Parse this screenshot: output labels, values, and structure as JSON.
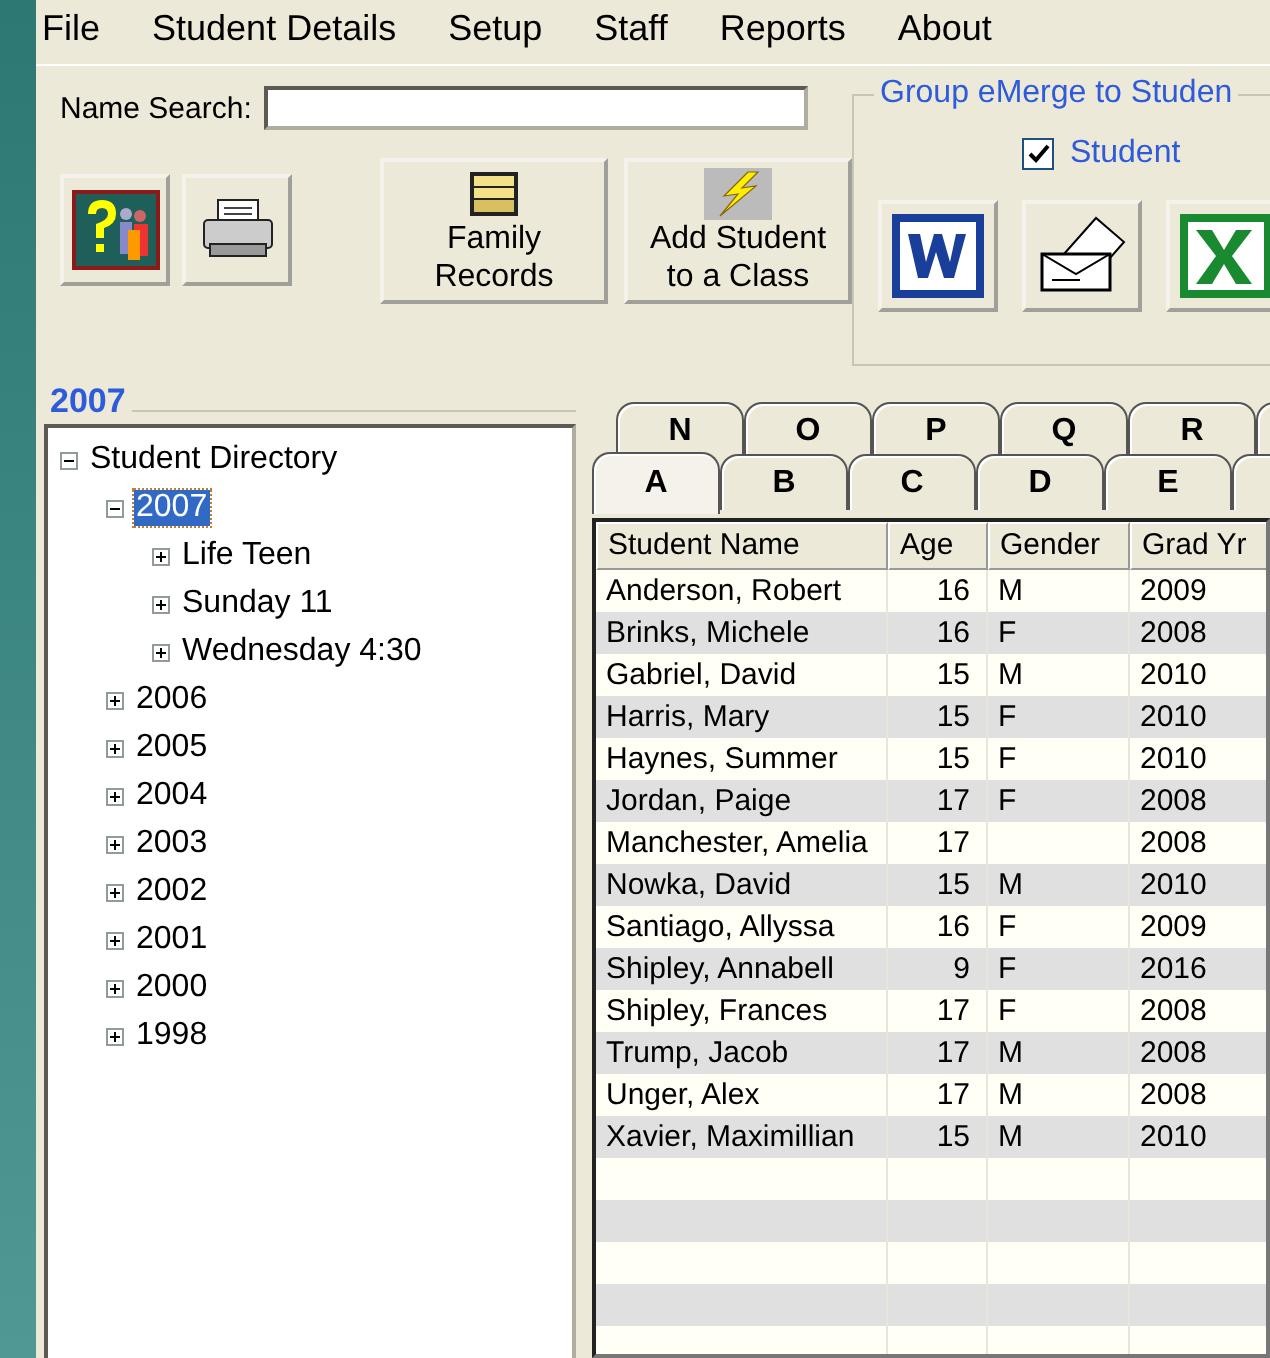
{
  "menu": [
    "File",
    "Student Details",
    "Setup",
    "Staff",
    "Reports",
    "About"
  ],
  "name_search": {
    "label": "Name Search:"
  },
  "toolbar": [
    {
      "kind": "help"
    },
    {
      "kind": "print"
    },
    {
      "kind": "family",
      "label": "Family\nRecords"
    },
    {
      "kind": "add",
      "label": "Add Student\nto a Class"
    }
  ],
  "group": {
    "title": "Group eMerge to Studen",
    "student": {
      "label": "Student",
      "checked": true
    },
    "buttons": [
      {
        "kind": "word"
      },
      {
        "kind": "letter"
      },
      {
        "kind": "excel"
      }
    ]
  },
  "tree_panel": {
    "title": "2007",
    "tree": [
      {
        "label": "Student Directory",
        "expanded": true,
        "selected": false,
        "children": [
          {
            "label": "2007",
            "expanded": true,
            "selected": true,
            "children": [
              {
                "label": "Life Teen",
                "expanded": false,
                "selected": false
              },
              {
                "label": "Sunday 11",
                "expanded": false,
                "selected": false
              },
              {
                "label": "Wednesday 4:30",
                "expanded": false,
                "selected": false
              }
            ]
          },
          {
            "label": "2006",
            "expanded": false,
            "selected": false
          },
          {
            "label": "2005",
            "expanded": false,
            "selected": false
          },
          {
            "label": "2004",
            "expanded": false,
            "selected": false
          },
          {
            "label": "2003",
            "expanded": false,
            "selected": false
          },
          {
            "label": "2002",
            "expanded": false,
            "selected": false
          },
          {
            "label": "2001",
            "expanded": false,
            "selected": false
          },
          {
            "label": "2000",
            "expanded": false,
            "selected": false
          },
          {
            "label": "1998",
            "expanded": false,
            "selected": false
          }
        ]
      }
    ]
  },
  "tabs_back": [
    {
      "label": "N",
      "selected": false
    },
    {
      "label": "O",
      "selected": false
    },
    {
      "label": "P",
      "selected": false
    },
    {
      "label": "Q",
      "selected": false
    },
    {
      "label": "R",
      "selected": false
    }
  ],
  "tabs_front": [
    {
      "label": "A",
      "selected": true
    },
    {
      "label": "B",
      "selected": false
    },
    {
      "label": "C",
      "selected": false
    },
    {
      "label": "D",
      "selected": false
    },
    {
      "label": "E",
      "selected": false
    }
  ],
  "table": {
    "columns": [
      "Student Name",
      "Age",
      "Gender",
      "Grad Yr"
    ],
    "rows": [
      [
        "Anderson, Robert",
        "16",
        "M",
        "2009"
      ],
      [
        "Brinks, Michele",
        "16",
        "F",
        "2008"
      ],
      [
        "Gabriel, David",
        "15",
        "M",
        "2010"
      ],
      [
        "Harris, Mary",
        "15",
        "F",
        "2010"
      ],
      [
        "Haynes, Summer",
        "15",
        "F",
        "2010"
      ],
      [
        "Jordan, Paige",
        "17",
        "F",
        "2008"
      ],
      [
        "Manchester, Amelia",
        "17",
        "",
        "2008"
      ],
      [
        "Nowka, David",
        "15",
        "M",
        "2010"
      ],
      [
        "Santiago, Allyssa",
        "16",
        "F",
        "2009"
      ],
      [
        "Shipley, Annabell",
        "9",
        "F",
        "2016"
      ],
      [
        "Shipley, Frances",
        "17",
        "F",
        "2008"
      ],
      [
        "Trump, Jacob",
        "17",
        "M",
        "2008"
      ],
      [
        "Unger, Alex",
        "17",
        "M",
        "2008"
      ],
      [
        "Xavier, Maximillian",
        "15",
        "M",
        "2010"
      ]
    ]
  }
}
